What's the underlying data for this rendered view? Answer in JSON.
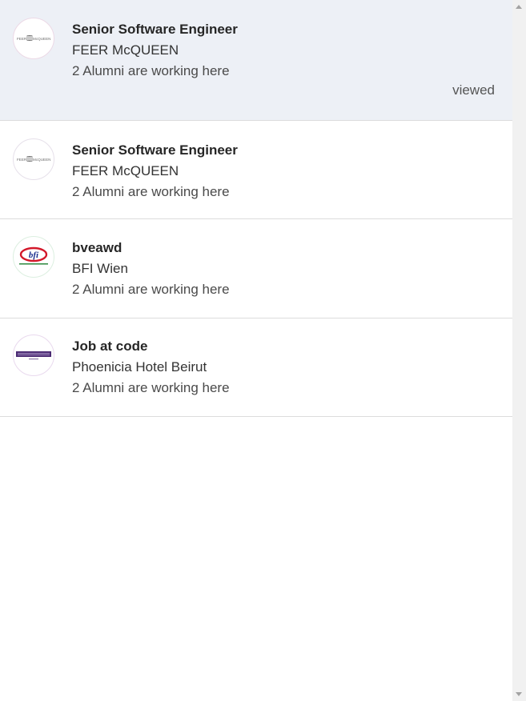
{
  "jobs": [
    {
      "title": "Senior Software Engineer",
      "company": "FEER McQUEEN",
      "alumni": "2 Alumni are working here",
      "status": "viewed",
      "logo": {
        "name": "feer-mcqueen-logo",
        "text": "FEER McQUEEN",
        "color": "#6b6b6b"
      }
    },
    {
      "title": "Senior Software Engineer",
      "company": "FEER McQUEEN",
      "alumni": "2 Alumni are working here",
      "logo": {
        "name": "feer-mcqueen-logo",
        "text": "FEER McQUEEN",
        "color": "#6b6b6b"
      }
    },
    {
      "title": "bveawd",
      "company": "BFI Wien",
      "alumni": "2 Alumni are working here",
      "logo": {
        "name": "bfi-wien-logo",
        "text": "bfi",
        "color": "#1b2f8f",
        "accent": "#d3182a"
      }
    },
    {
      "title": "Job at code",
      "company": "Phoenicia Hotel Beirut",
      "alumni": "2 Alumni are working here",
      "logo": {
        "name": "phoenicia-hotel-logo",
        "text": "PHOENICIA",
        "color": "#4b2a73"
      }
    }
  ],
  "scrollbar": {
    "up_icon": "scroll-up-arrow-icon",
    "down_icon": "scroll-down-arrow-icon"
  }
}
